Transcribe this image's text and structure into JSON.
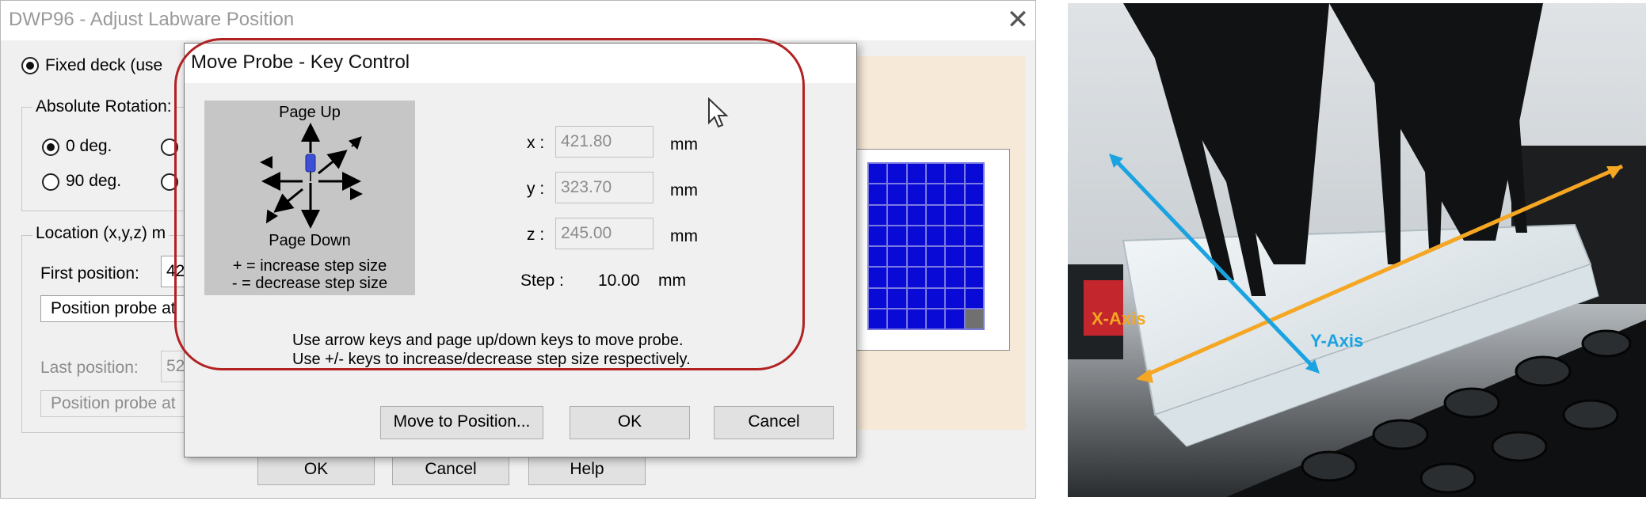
{
  "back_window": {
    "title": "DWP96 - Adjust Labware Position",
    "close_glyph": "✕",
    "fixed_deck_label": "Fixed deck (use",
    "absolute_rotation_label": "Absolute Rotation:",
    "rotation_0": "0 deg.",
    "rotation_90": "90 deg.",
    "location_label": "Location (x,y,z) m",
    "first_position_label": "First position:",
    "first_position_value": "42",
    "position_probe_1": "Position probe at",
    "last_position_label": "Last position:",
    "last_position_value": "52",
    "position_probe_2": "Position probe at",
    "ok_label": "OK",
    "cancel_label": "Cancel",
    "help_label": "Help"
  },
  "probe_dialog": {
    "title": "Move Probe - Key Control",
    "key_panel": {
      "page_up": "Page Up",
      "page_down": "Page Down",
      "plus_hint": "+ = increase step size",
      "minus_hint": "- = decrease step size"
    },
    "x_label": "x :",
    "x_value": "421.80",
    "y_label": "y :",
    "y_value": "323.70",
    "z_label": "z :",
    "z_value": "245.00",
    "unit": "mm",
    "step_label": "Step :",
    "step_value": "10.00",
    "instruction_1": "Use arrow keys and page up/down keys to move probe.",
    "instruction_2": "Use +/- keys to increase/decrease step size respectively.",
    "move_to_position_label": "Move to Position...",
    "ok_label": "OK",
    "cancel_label": "Cancel"
  },
  "photo": {
    "x_axis_label": "X-Axis",
    "y_axis_label": "Y-Axis",
    "x_axis_color": "#f5a623",
    "y_axis_color": "#1aa3e0"
  },
  "colors": {
    "highlight": "#b22222",
    "plate_well": "#0a0ad6"
  }
}
